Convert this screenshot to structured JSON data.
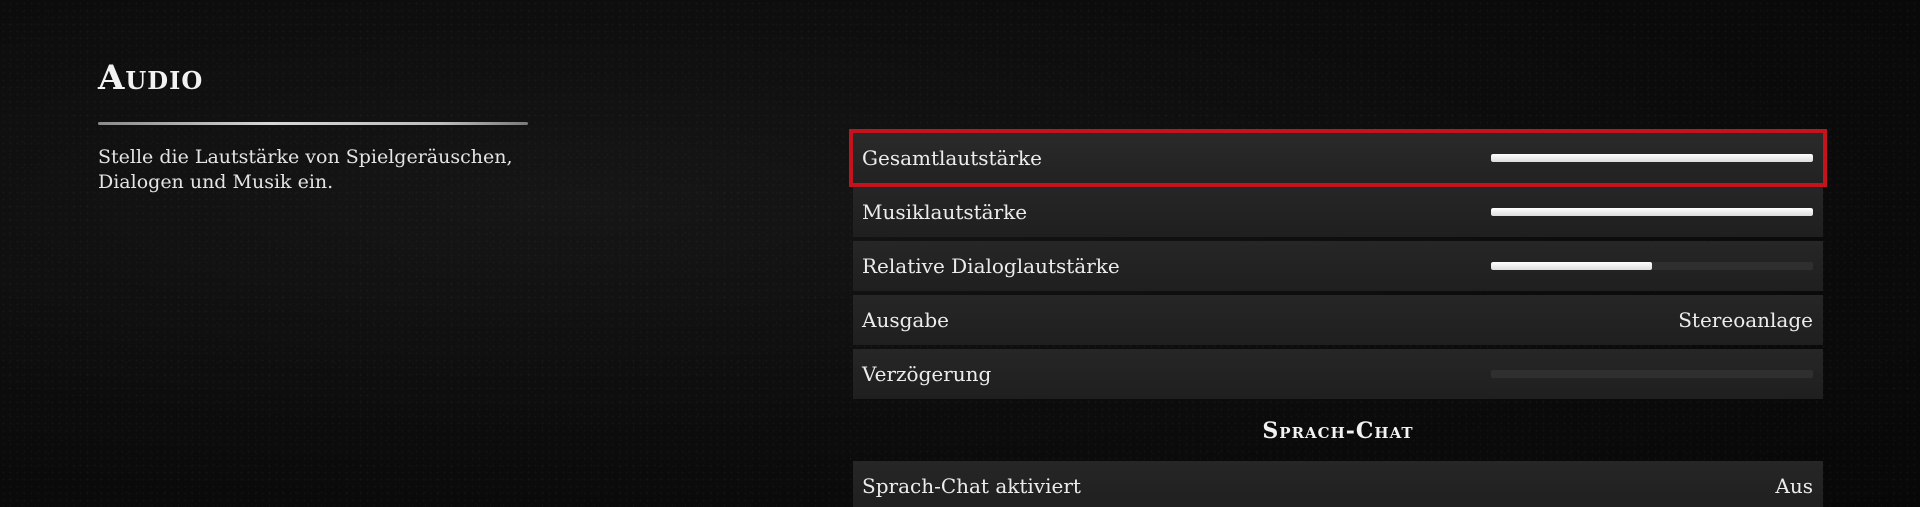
{
  "page": {
    "title": "Audio",
    "description": "Stelle die Lautstärke von Spielgeräuschen,\nDialogen und Musik ein."
  },
  "settings": [
    {
      "label": "Gesamtlautstärke",
      "type": "slider",
      "level": 1.0,
      "selected": true
    },
    {
      "label": "Musiklautstärke",
      "type": "slider",
      "level": 1.0
    },
    {
      "label": "Relative Dialoglautstärke",
      "type": "slider",
      "level": 0.5
    },
    {
      "label": "Ausgabe",
      "type": "option",
      "value": "Stereoanlage"
    },
    {
      "label": "Verzögerung",
      "type": "slider",
      "level": 0.0
    }
  ],
  "voice_chat": {
    "header": "Sprach-Chat",
    "items": [
      {
        "label": "Sprach-Chat aktiviert",
        "type": "option",
        "value": "Aus"
      }
    ]
  },
  "colors": {
    "selection_outline": "#c3141d",
    "row_background": "#232323",
    "slider_fill": "#f0f0f0",
    "slider_track": "#2f2f2f"
  }
}
